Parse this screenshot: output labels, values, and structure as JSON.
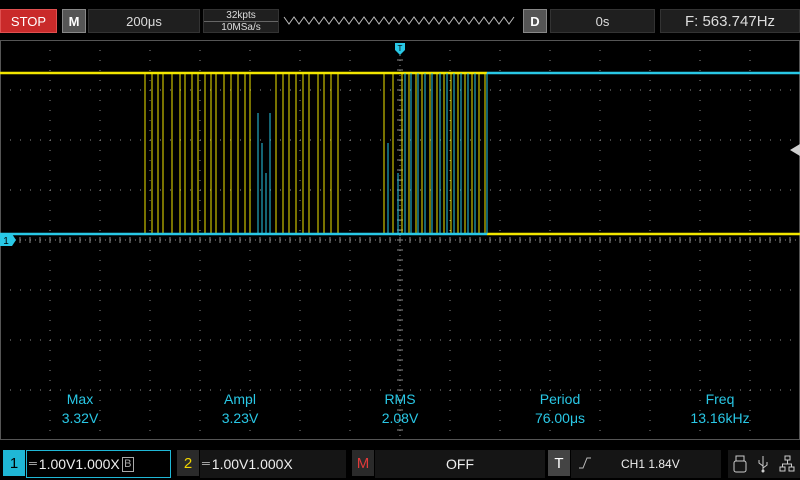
{
  "topbar": {
    "run_state": "STOP",
    "mode_label": "M",
    "timebase": "200μs",
    "memory_depth": "32kpts",
    "sample_rate": "10MSa/s",
    "delay_label": "D",
    "trigger_delay": "0s",
    "frequency_counter": "F: 563.747Hz"
  },
  "markers": {
    "trigger_marker": "T",
    "ch1_marker": "1"
  },
  "measurements": [
    {
      "label": "Max",
      "value": "3.32V"
    },
    {
      "label": "Ampl",
      "value": "3.23V"
    },
    {
      "label": "RMS",
      "value": "2.08V"
    },
    {
      "label": "Period",
      "value": "76.00μs"
    },
    {
      "label": "Freq",
      "value": "13.16kHz"
    }
  ],
  "bottombar": {
    "ch1": {
      "badge": "1",
      "coupling_icon": "dc-coupling-icon",
      "scale": "1.00V",
      "probe": "1.000X",
      "bw_limit": "B"
    },
    "ch2": {
      "badge": "2",
      "coupling_icon": "dc-coupling-icon",
      "scale": "1.00V",
      "probe": "1.000X"
    },
    "math": {
      "badge": "M",
      "state": "OFF"
    },
    "trigger": {
      "badge": "T",
      "edge_icon": "rising-edge-icon",
      "source_level": "CH1 1.84V"
    },
    "status_icons": [
      "usb-drive-icon",
      "usb-icon",
      "network-icon"
    ]
  },
  "colors": {
    "ch1": "#29c8e6",
    "ch2": "#f2e600",
    "grid": "#8a8a8a",
    "stop": "#c92a2a"
  }
}
